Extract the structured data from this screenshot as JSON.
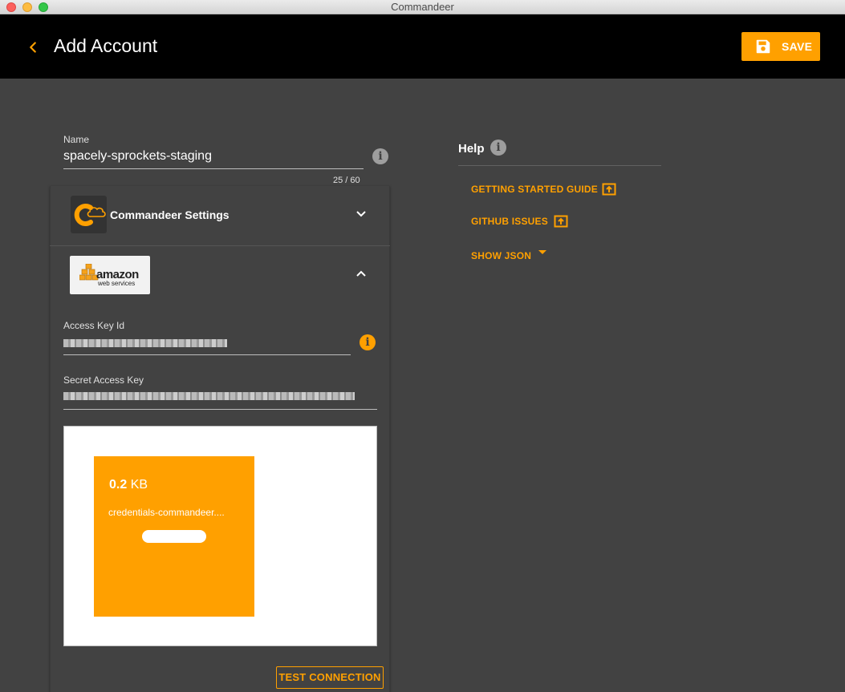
{
  "window": {
    "title": "Commandeer"
  },
  "header": {
    "title": "Add Account",
    "save_label": "SAVE"
  },
  "name_field": {
    "label": "Name",
    "value": "spacely-sprockets-staging",
    "counter": "25 / 60"
  },
  "commandeer_settings": {
    "title": "Commandeer Settings"
  },
  "aws": {
    "logo_word": "amazon",
    "logo_sub": "web services",
    "access_key_label": "Access Key Id",
    "secret_key_label": "Secret Access Key"
  },
  "upload": {
    "size_value": "0.2",
    "size_unit": "KB",
    "file_name": "credentials-commandeer...."
  },
  "test_connection_label": "TEST CONNECTION",
  "help": {
    "title": "Help",
    "links": [
      "GETTING STARTED GUIDE",
      "GITHUB ISSUES",
      "SHOW JSON"
    ]
  },
  "colors": {
    "accent": "#ffa000",
    "background": "#424242",
    "header": "#000000"
  }
}
